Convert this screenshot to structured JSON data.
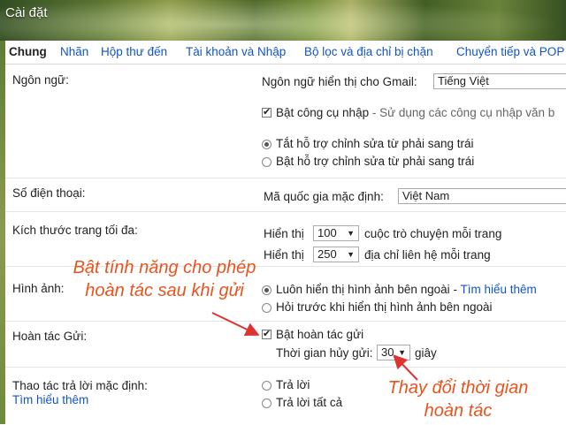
{
  "window": {
    "title": "Cài đặt"
  },
  "tabs": [
    {
      "label": "Chung"
    },
    {
      "label": "Nhãn"
    },
    {
      "label": "Hộp thư đến"
    },
    {
      "label": "Tài khoản và Nhập"
    },
    {
      "label": "Bộ lọc và địa chỉ bị chặn"
    },
    {
      "label": "Chuyển tiếp và POP"
    }
  ],
  "language": {
    "label": "Ngôn ngữ:",
    "display_label": "Ngôn ngữ hiển thị cho Gmail:",
    "display_value": "Tiếng Việt",
    "input_tools_label": "Bật công cụ nhập",
    "input_tools_desc": " - Sử dụng các công cụ nhập văn b",
    "rtl_on": "Tắt hỗ trợ chỉnh sửa từ phải sang trái",
    "rtl_off": "Bật hỗ trợ chỉnh sửa từ phải sang trái"
  },
  "phone": {
    "label": "Số điện thoại:",
    "country_label": "Mã quốc gia mặc định:",
    "country_value": "Việt Nam"
  },
  "page_size": {
    "label": "Kích thước trang tối đa:",
    "show": "Hiển thị",
    "conv_value": "100",
    "conv_suffix": "cuộc trò chuyện mỗi trang",
    "contact_value": "250",
    "contact_suffix": "địa chỉ liên hệ mỗi trang"
  },
  "images": {
    "label": "Hình ảnh:",
    "always": "Luôn hiển thị hình ảnh bên ngoài",
    "learn_more": "Tìm hiểu thêm",
    "ask": "Hỏi trước khi hiển thị hình ảnh bên ngoài"
  },
  "undo": {
    "label": "Hoàn tác Gửi:",
    "enable": "Bật hoàn tác gửi",
    "period_label": "Thời gian hủy gửi:",
    "period_value": "30",
    "period_unit": "giây"
  },
  "reply": {
    "label": "Thao tác trả lời mặc định:",
    "learn_more": "Tìm hiểu thêm",
    "reply": "Trả lời",
    "reply_all": "Trả lời tất cả"
  },
  "annotations": {
    "enable_line1": "Bật tính năng cho phép",
    "enable_line2": "hoàn tác sau khi gửi",
    "time_line1": "Thay đổi thời gian",
    "time_line2": "hoàn tác"
  },
  "colors": {
    "link": "#1155cc",
    "annotation": "#e8541e"
  }
}
